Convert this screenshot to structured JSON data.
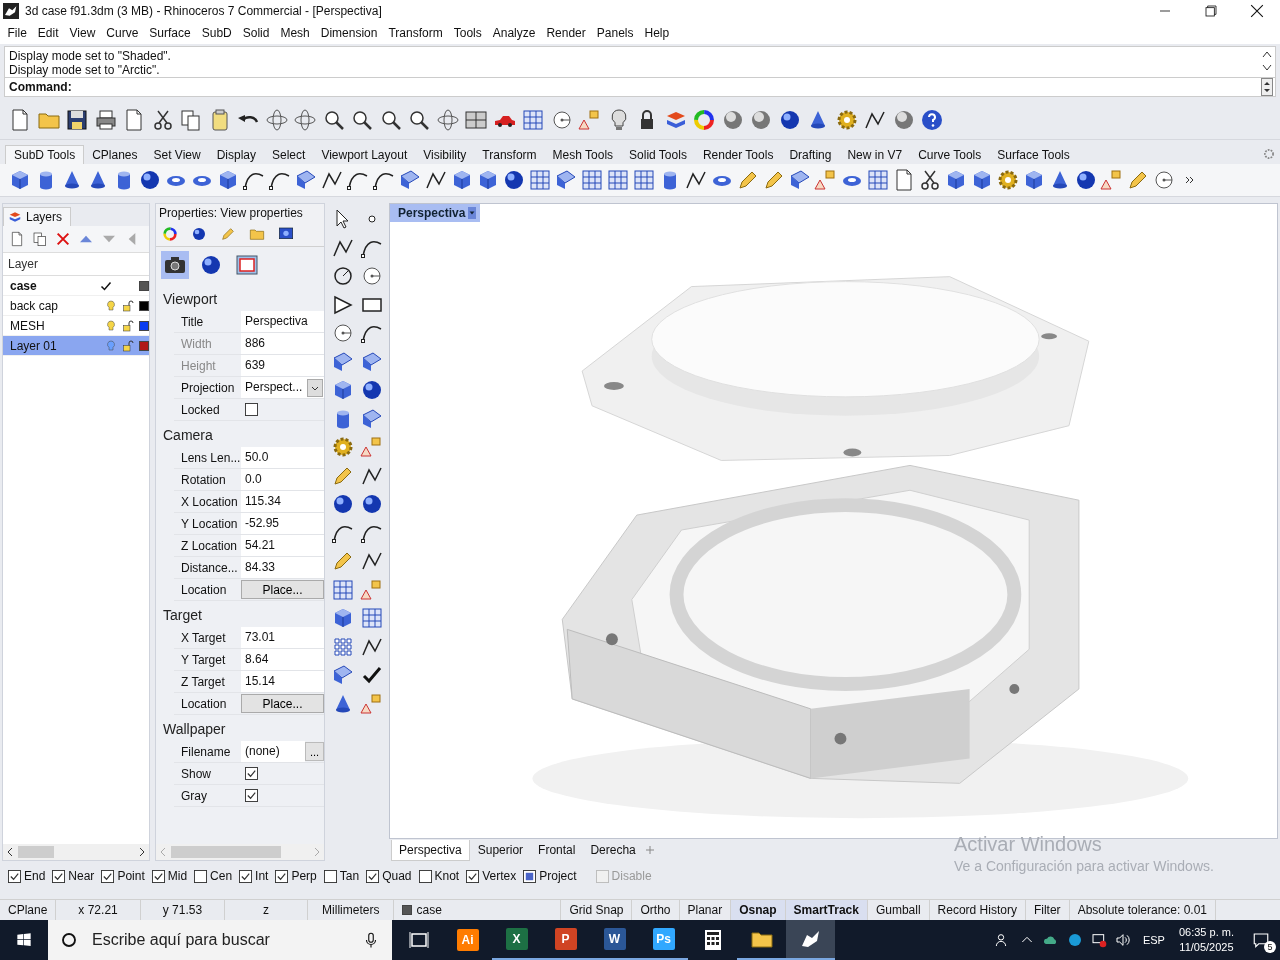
{
  "window": {
    "title": "3d case f91.3dm (3 MB) - Rhinoceros 7 Commercial - [Perspectiva]"
  },
  "menu": [
    "File",
    "Edit",
    "View",
    "Curve",
    "Surface",
    "SubD",
    "Solid",
    "Mesh",
    "Dimension",
    "Transform",
    "Tools",
    "Analyze",
    "Render",
    "Panels",
    "Help"
  ],
  "command_history": [
    "Display mode set to \"Shaded\".",
    "Display mode set to \"Arctic\"."
  ],
  "command_prompt": "Command:",
  "toolbar_tabs": [
    {
      "label": "SubD Tools",
      "selected": true
    },
    {
      "label": "CPlanes",
      "selected": false
    },
    {
      "label": "Set View",
      "selected": false
    },
    {
      "label": "Display",
      "selected": false
    },
    {
      "label": "Select",
      "selected": false
    },
    {
      "label": "Viewport Layout",
      "selected": false
    },
    {
      "label": "Visibility",
      "selected": false
    },
    {
      "label": "Transform",
      "selected": false
    },
    {
      "label": "Mesh Tools",
      "selected": false
    },
    {
      "label": "Solid Tools",
      "selected": false
    },
    {
      "label": "Render Tools",
      "selected": false
    },
    {
      "label": "Drafting",
      "selected": false
    },
    {
      "label": "New in V7",
      "selected": false
    },
    {
      "label": "Curve Tools",
      "selected": false
    },
    {
      "label": "Surface Tools",
      "selected": false
    }
  ],
  "layers_panel": {
    "title": "Layers",
    "column": "Layer",
    "layers": [
      {
        "name": "case",
        "current": true,
        "selected": false,
        "color": "#555555"
      },
      {
        "name": "back cap",
        "current": false,
        "selected": false,
        "color": "#000000"
      },
      {
        "name": "MESH",
        "current": false,
        "selected": false,
        "color": "#0a3cf0"
      },
      {
        "name": "Layer 01",
        "current": false,
        "selected": true,
        "color": "#b01818"
      }
    ]
  },
  "properties_panel": {
    "title": "Properties: View properties",
    "sections": [
      {
        "heading": "Viewport",
        "rows": [
          {
            "label": "Title",
            "kind": "text",
            "value": "Perspectiva",
            "disabled": false
          },
          {
            "label": "Width",
            "kind": "text",
            "value": "886",
            "disabled": true
          },
          {
            "label": "Height",
            "kind": "text",
            "value": "639",
            "disabled": true
          },
          {
            "label": "Projection",
            "kind": "dropdown",
            "value": "Perspect...",
            "disabled": false
          },
          {
            "label": "Locked",
            "kind": "checkbox",
            "checked": false,
            "disabled": false
          }
        ]
      },
      {
        "heading": "Camera",
        "rows": [
          {
            "label": "Lens Len...",
            "kind": "text",
            "value": "50.0",
            "disabled": false
          },
          {
            "label": "Rotation",
            "kind": "text",
            "value": "0.0",
            "disabled": false
          },
          {
            "label": "X Location",
            "kind": "text",
            "value": "115.34",
            "disabled": false
          },
          {
            "label": "Y Location",
            "kind": "text",
            "value": "-52.95",
            "disabled": false
          },
          {
            "label": "Z Location",
            "kind": "text",
            "value": "54.21",
            "disabled": false
          },
          {
            "label": "Distance...",
            "kind": "text",
            "value": "84.33",
            "disabled": false
          },
          {
            "label": "Location",
            "kind": "button",
            "value": "Place...",
            "disabled": false
          }
        ]
      },
      {
        "heading": "Target",
        "rows": [
          {
            "label": "X Target",
            "kind": "text",
            "value": "73.01",
            "disabled": false
          },
          {
            "label": "Y Target",
            "kind": "text",
            "value": "8.64",
            "disabled": false
          },
          {
            "label": "Z Target",
            "kind": "text",
            "value": "15.14",
            "disabled": false
          },
          {
            "label": "Location",
            "kind": "button",
            "value": "Place...",
            "disabled": false
          }
        ]
      },
      {
        "heading": "Wallpaper",
        "rows": [
          {
            "label": "Filename",
            "kind": "file",
            "value": "(none)",
            "button": "...",
            "disabled": false
          },
          {
            "label": "Show",
            "kind": "checkbox",
            "checked": true,
            "disabled": false
          },
          {
            "label": "Gray",
            "kind": "checkbox",
            "checked": true,
            "disabled": false
          }
        ]
      }
    ]
  },
  "viewport": {
    "label": "Perspectiva",
    "tabs": [
      {
        "label": "Perspectiva",
        "selected": true
      },
      {
        "label": "Superior",
        "selected": false
      },
      {
        "label": "Frontal",
        "selected": false
      },
      {
        "label": "Derecha",
        "selected": false
      }
    ]
  },
  "osnaps": [
    {
      "label": "End",
      "kind": "check",
      "checked": true,
      "disabled": false
    },
    {
      "label": "Near",
      "kind": "check",
      "checked": true,
      "disabled": false
    },
    {
      "label": "Point",
      "kind": "check",
      "checked": true,
      "disabled": false
    },
    {
      "label": "Mid",
      "kind": "check",
      "checked": true,
      "disabled": false
    },
    {
      "label": "Cen",
      "kind": "check",
      "checked": false,
      "disabled": false
    },
    {
      "label": "Int",
      "kind": "check",
      "checked": true,
      "disabled": false
    },
    {
      "label": "Perp",
      "kind": "check",
      "checked": true,
      "disabled": false
    },
    {
      "label": "Tan",
      "kind": "check",
      "checked": false,
      "disabled": false
    },
    {
      "label": "Quad",
      "kind": "check",
      "checked": true,
      "disabled": false
    },
    {
      "label": "Knot",
      "kind": "check",
      "checked": false,
      "disabled": false
    },
    {
      "label": "Vertex",
      "kind": "check",
      "checked": true,
      "disabled": false
    },
    {
      "label": "Project",
      "kind": "filled",
      "checked": true,
      "disabled": false
    },
    {
      "label": "Disable",
      "kind": "check",
      "checked": false,
      "disabled": true
    }
  ],
  "status_bar": [
    {
      "text": "CPlane",
      "kind": "text"
    },
    {
      "text": "x 72.21",
      "kind": "text"
    },
    {
      "text": "y 71.53",
      "kind": "text"
    },
    {
      "text": "z",
      "kind": "text"
    },
    {
      "text": "Millimeters",
      "kind": "text"
    },
    {
      "text": "case",
      "kind": "layer",
      "color": "#555555"
    },
    {
      "text": "Grid Snap",
      "kind": "toggle",
      "on": false
    },
    {
      "text": "Ortho",
      "kind": "toggle",
      "on": false
    },
    {
      "text": "Planar",
      "kind": "toggle",
      "on": false
    },
    {
      "text": "Osnap",
      "kind": "toggle",
      "on": true
    },
    {
      "text": "SmartTrack",
      "kind": "toggle",
      "on": true
    },
    {
      "text": "Gumball",
      "kind": "toggle",
      "on": false
    },
    {
      "text": "Record History",
      "kind": "toggle",
      "on": false
    },
    {
      "text": "Filter",
      "kind": "toggle",
      "on": false
    },
    {
      "text": "Absolute tolerance: 0.01",
      "kind": "text"
    }
  ],
  "activation": {
    "title": "Activar Windows",
    "text": "Ve a Configuración para activar Windows."
  },
  "taskbar": {
    "search_placeholder": "Escribe aquí para buscar",
    "apps": [
      {
        "kind": "taskview",
        "running": false,
        "selected": false
      },
      {
        "kind": "tile",
        "label": "Ai",
        "color": "#ff7c00",
        "running": false,
        "selected": false
      },
      {
        "kind": "tile",
        "label": "X",
        "color": "#1d7044",
        "running": true,
        "selected": false
      },
      {
        "kind": "tile",
        "label": "P",
        "color": "#d04423",
        "running": true,
        "selected": false
      },
      {
        "kind": "tile",
        "label": "W",
        "color": "#2b5797",
        "running": true,
        "selected": false
      },
      {
        "kind": "tile",
        "label": "Ps",
        "color": "#31a8ff",
        "running": true,
        "selected": false
      },
      {
        "kind": "calculator",
        "running": false,
        "selected": false
      },
      {
        "kind": "folder",
        "running": true,
        "selected": false
      },
      {
        "kind": "rhino",
        "running": true,
        "selected": true
      }
    ],
    "language": "ESP",
    "time": "06:35 p. m.",
    "date": "11/05/2025",
    "notifications": "5"
  }
}
